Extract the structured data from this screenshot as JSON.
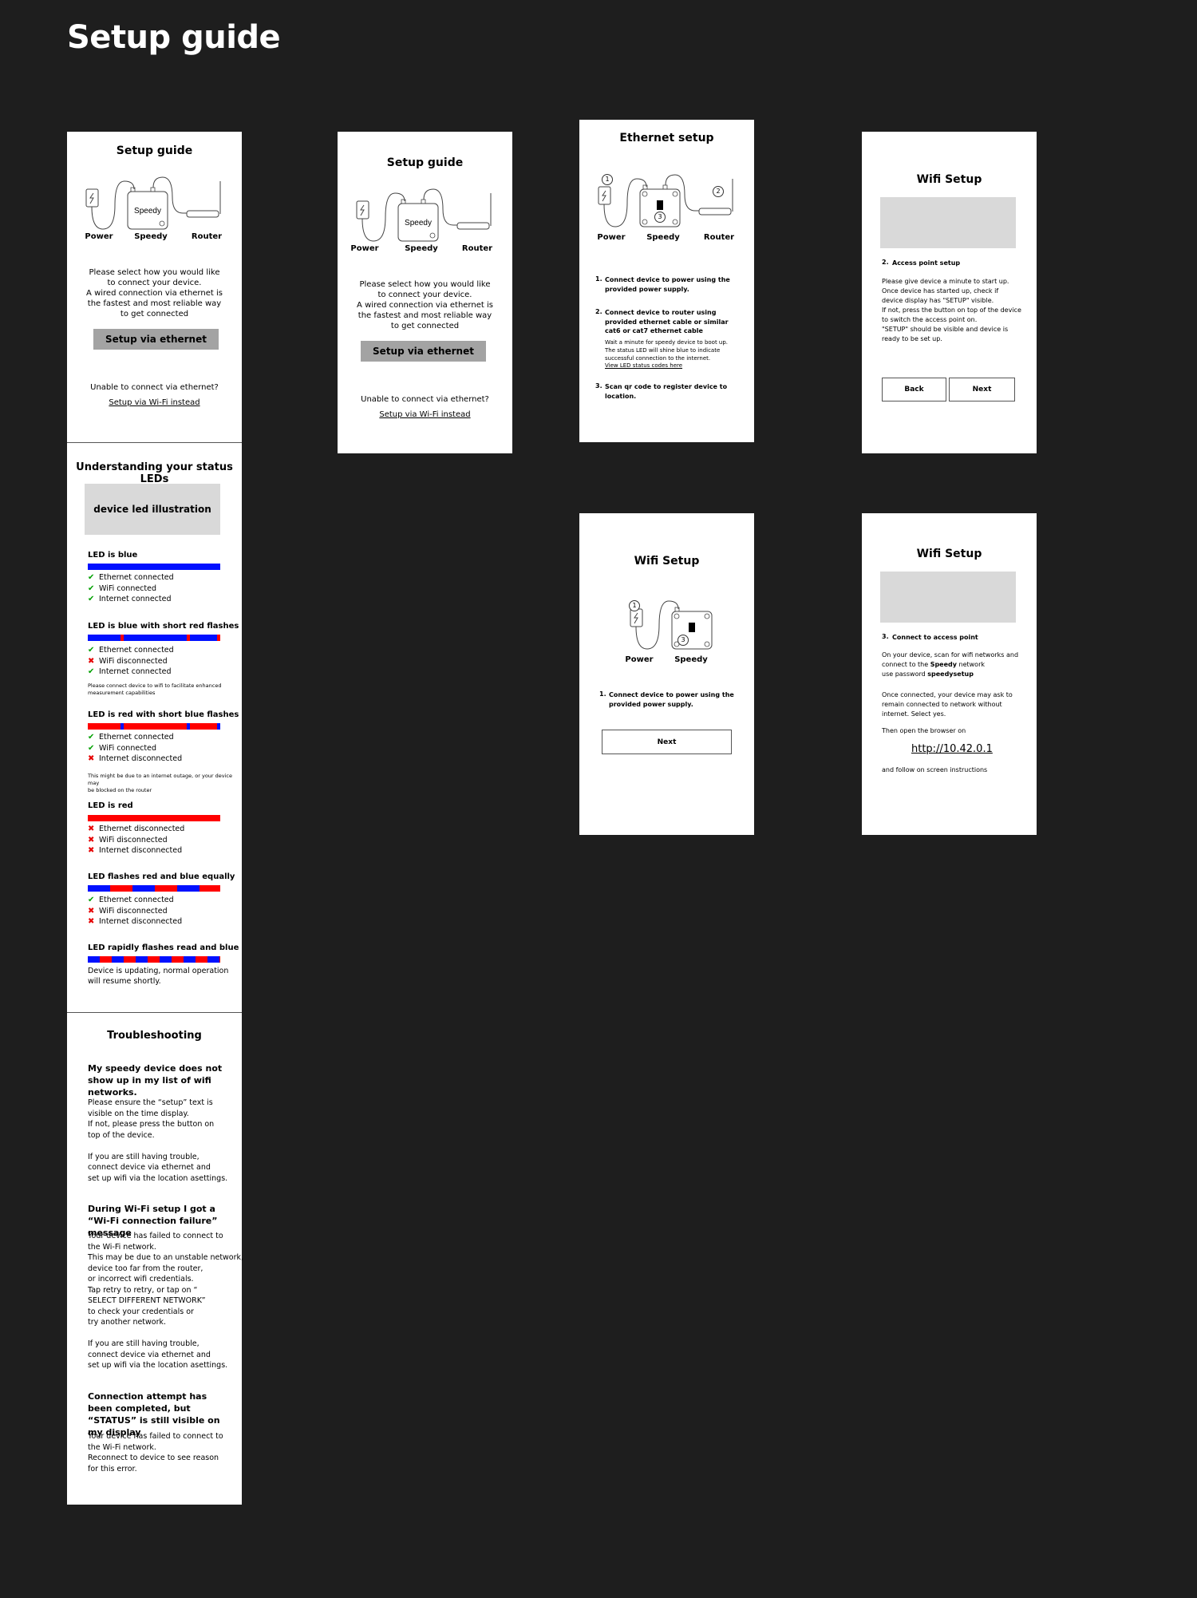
{
  "page_title": "Setup guide",
  "diagram": {
    "power": "Power",
    "speedy": "Speedy",
    "router": "Router",
    "device_text": "Speedy"
  },
  "frame1": {
    "title": "Setup guide",
    "intro": "Please select how you would like\nto connect your device.\nA wired connection via ethernet is\nthe fastest and most reliable way\nto get connected",
    "ethernet_button": "Setup via ethernet",
    "unable": "Unable to connect via ethernet?",
    "wifi_link": "Setup via Wi-Fi instead"
  },
  "frame2": {
    "title": "Setup guide",
    "intro": "Please select how you would like\nto connect your device.\nA wired connection via ethernet is\nthe fastest and most reliable way\nto get connected",
    "ethernet_button": "Setup via ethernet",
    "unable": "Unable to connect via ethernet?",
    "wifi_link": "Setup via Wi-Fi instead"
  },
  "ethernet": {
    "title": "Ethernet setup",
    "step1_num": "1.",
    "step1": "Connect device to power using the provided power supply.",
    "step2_num": "2.",
    "step2": "Connect device to router using provided ethernet cable or similar cat6 or cat7 ethernet cable",
    "step2_detail": "Wait a minute for speedy device to boot up.\nThe status LED will shine blue to indicate\nsuccessful connection to the internet.",
    "step2_link": "View LED status codes here",
    "step3_num": "3.",
    "step3": "Scan qr code to register device to location.",
    "marker1": "1",
    "marker2": "2",
    "marker3": "3"
  },
  "wifi_ap": {
    "title": "Wifi Setup",
    "step_num": "2.",
    "step_title": "Access point setup",
    "body": "Please give device a minute to start up.\nOnce device has started up, check if\ndevice display has \"SETUP\" visible.\nIf not, press the button on top of the device\nto switch the access point on.\n\"SETUP\" should be visible and device is\nready to be set up.",
    "back": "Back",
    "next": "Next"
  },
  "wifi_power": {
    "title": "Wifi Setup",
    "step_num": "1.",
    "step": "Connect device to power using the provided power supply.",
    "next": "Next",
    "marker1": "1",
    "marker3": "3"
  },
  "wifi_connect": {
    "title": "Wifi Setup",
    "step_num": "3.",
    "step_title": "Connect to access point",
    "p1a": "On your device, scan for wifi networks and",
    "p1b_pre": "connect to the ",
    "p1b_bold": "Speedy",
    "p1b_post": " network",
    "p1c_pre": "use password ",
    "p1c_bold": "speedysetup",
    "p2": "Once connected, your device may ask to\nremain connected to network without\ninternet. Select yes.",
    "p3": "Then open the browser on",
    "url": "http://10.42.0.1",
    "p4": "and follow on screen instructions"
  },
  "leds": {
    "title": "Understanding your status LEDs",
    "illustration": "device led illustration",
    "groups": [
      {
        "title": "LED is blue",
        "items": [
          [
            "check",
            "Ethernet connected"
          ],
          [
            "check",
            "WiFi connected"
          ],
          [
            "check",
            "Internet connected"
          ]
        ]
      },
      {
        "title": "LED is blue with short red flashes",
        "items": [
          [
            "check",
            "Ethernet connected"
          ],
          [
            "cross",
            "WiFi disconnected"
          ],
          [
            "check",
            "Internet connected"
          ]
        ],
        "note": "Please connect device to wifi to facilitate enhanced\nmeasurement capabilities"
      },
      {
        "title": "LED is red with short blue flashes",
        "items": [
          [
            "check",
            "Ethernet connected"
          ],
          [
            "check",
            "WiFi connected"
          ],
          [
            "cross",
            "Internet disconnected"
          ]
        ],
        "note": "This might be due to an internet outage, or your device may\nbe blocked on the router"
      },
      {
        "title": "LED is red",
        "items": [
          [
            "cross",
            "Ethernet disconnected"
          ],
          [
            "cross",
            "WiFi disconnected"
          ],
          [
            "cross",
            "Internet disconnected"
          ]
        ]
      },
      {
        "title": "LED flashes red and blue equally",
        "items": [
          [
            "check",
            "Ethernet connected"
          ],
          [
            "cross",
            "WiFi disconnected"
          ],
          [
            "cross",
            "Internet disconnected"
          ]
        ]
      },
      {
        "title": "LED rapidly flashes read and blue",
        "text": "Device is updating, normal operation\nwill resume shortly."
      }
    ]
  },
  "troubleshooting": {
    "title": "Troubleshooting",
    "q1": "My speedy device does not show up in my list of wifi networks.",
    "a1": "Please ensure the “setup” text is\nvisible on the time display.\nIf not, please press the button on\ntop of the device.\n\nIf you are still having trouble,\nconnect device via ethernet and\nset up wifi via the location asettings.",
    "q2": "During Wi-Fi setup I got a “Wi-Fi connection failure” message",
    "a2": "Your device has failed to connect to\nthe Wi-Fi network.\nThis may be due to an unstable network,\ndevice too far from the router,\nor incorrect wifi credentials.\nTap retry to retry, or tap on “\nSELECT DIFFERENT NETWORK”\n to check your credentials or\ntry another network.\n\nIf you are still having trouble,\nconnect device via ethernet and\nset up wifi via the location asettings.",
    "q3": "Connection attempt has been completed, but “STATUS” is still visible on my display",
    "a3": "Your device has failed to connect to\nthe Wi-Fi network.\nReconnect to device to see reason\nfor this error."
  },
  "colors": {
    "background": "#1e1e1e",
    "led_blue": "#0010ff",
    "led_red": "#ff0000",
    "check": "#00a000",
    "cross": "#e60000"
  }
}
